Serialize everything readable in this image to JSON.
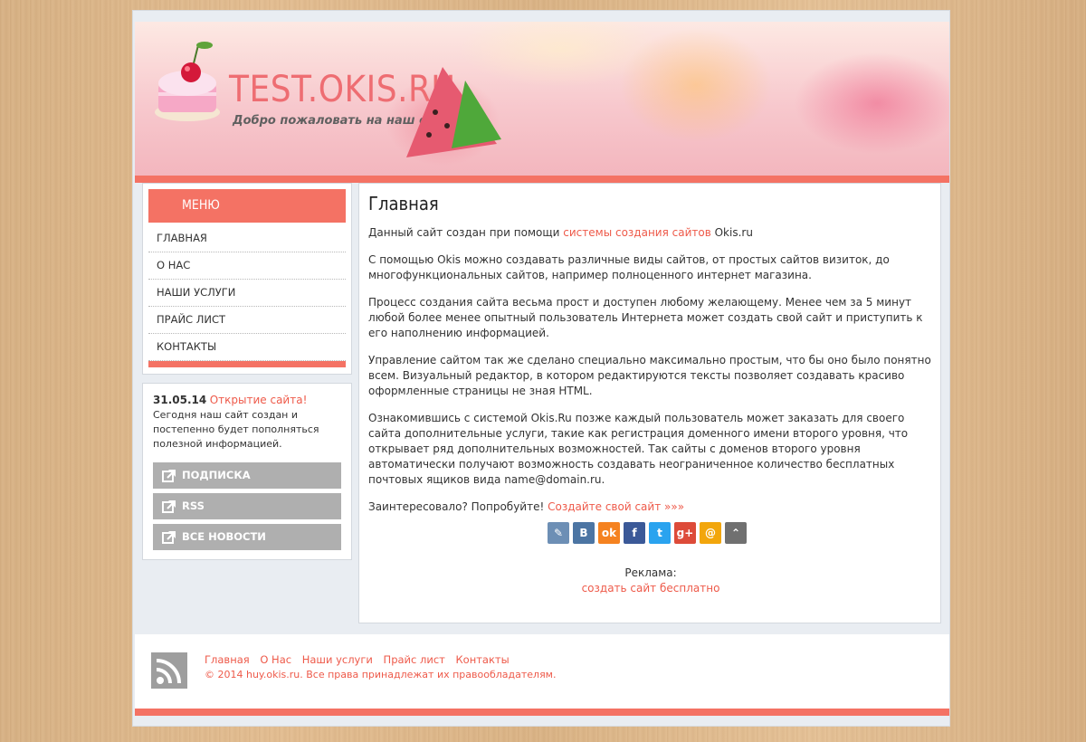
{
  "header": {
    "site_title": "TEST.OKIS.RU",
    "tagline": "Добро пожаловать на наш сайт!"
  },
  "menu": {
    "heading": "МЕНЮ",
    "items": [
      "ГЛАВНАЯ",
      "О НАС",
      "НАШИ УСЛУГИ",
      "ПРАЙС ЛИСТ",
      "КОНТАКТЫ"
    ]
  },
  "news": {
    "date": "31.05.14",
    "title": "Открытие сайта!",
    "text": "Сегодня наш сайт создан и постепенно будет пополняться полезной информацией.",
    "buttons": [
      "ПОДПИСКА",
      "RSS",
      "ВСЕ НОВОСТИ"
    ]
  },
  "content": {
    "heading": "Главная",
    "p1_before": "Данный сайт создан при помощи ",
    "p1_link": "системы создания сайтов",
    "p1_after": " Okis.ru",
    "p2": "С помощью Okis можно создавать различные виды сайтов, от простых сайтов визиток, до многофункциональных сайтов, например полноценного интернет магазина.",
    "p3": "Процесс создания сайта весьма прост и доступен любому желающему. Менее чем за 5 минут любой более менее опытный пользователь Интернета может создать свой сайт и приступить к его наполнению информацией.",
    "p4": "Управление сайтом так же сделано специально максимально простым, что бы оно было понятно всем. Визуальный редактор, в котором редактируются тексты позволяет создавать красиво оформленные страницы не зная HTML.",
    "p5": "Ознакомившись с системой Okis.Ru позже каждый пользователь может заказать для своего сайта дополнительные услуги, такие как регистрация доменного имени второго уровня, что открывает ряд дополнительных возможностей. Так сайты с доменов второго уровня автоматически получают возможность создавать неограниченное количество бесплатных почтовых ящиков вида name@domain.ru.",
    "p6_before": "Заинтересовало? Попробуйте! ",
    "p6_link": "Создайте свой сайт »»»",
    "share_icons": [
      {
        "name": "livejournal-icon",
        "glyph": "✎",
        "color": "#6d8fb5"
      },
      {
        "name": "vkontakte-icon",
        "glyph": "B",
        "color": "#4c75a3"
      },
      {
        "name": "odnoklassniki-icon",
        "glyph": "ok",
        "color": "#f58220"
      },
      {
        "name": "facebook-icon",
        "glyph": "f",
        "color": "#3b5998"
      },
      {
        "name": "twitter-icon",
        "glyph": "t",
        "color": "#2aa3ef"
      },
      {
        "name": "googleplus-icon",
        "glyph": "g+",
        "color": "#dd4b39"
      },
      {
        "name": "mailru-icon",
        "glyph": "@",
        "color": "#f2a60c"
      },
      {
        "name": "more-icon",
        "glyph": "⌃",
        "color": "#707070"
      }
    ],
    "ad_label": "Реклама:",
    "ad_link": "создать сайт бесплатно"
  },
  "footer": {
    "nav": [
      "Главная",
      "О Нас",
      "Наши услуги",
      "Прайс лист",
      "Контакты"
    ],
    "copyright": "© 2014 huy.okis.ru. Все права принадлежат их правообладателям."
  }
}
